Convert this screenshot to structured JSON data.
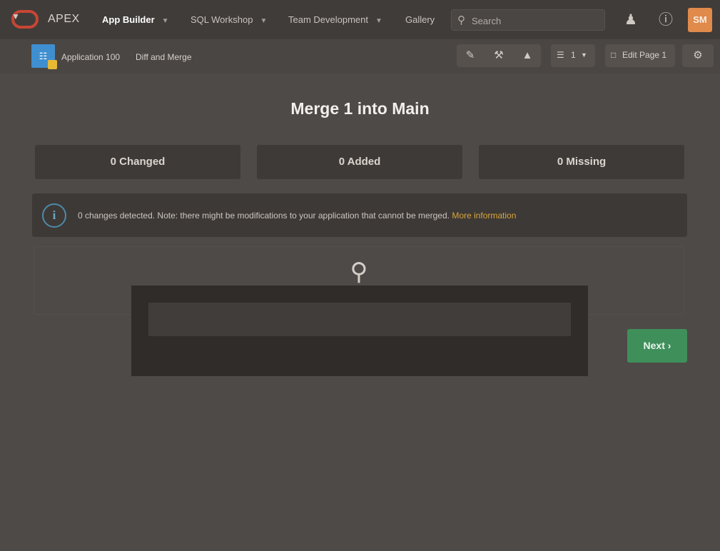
{
  "header": {
    "brand": "APEX",
    "nav": [
      {
        "label": "App Builder",
        "active": true,
        "has_menu": true
      },
      {
        "label": "SQL Workshop",
        "active": false,
        "has_menu": true
      },
      {
        "label": "Team Development",
        "active": false,
        "has_menu": true
      },
      {
        "label": "Gallery",
        "active": false,
        "has_menu": false
      }
    ],
    "search_placeholder": "Search",
    "search_icon": "magnifier-icon",
    "icons": [
      "people-icon",
      "help-icon"
    ],
    "avatar_initials": "SM",
    "colors": {
      "brand_logo": "#c74634",
      "avatar": "#e08a4c"
    }
  },
  "subheader": {
    "breadcrumb": [
      "Application 100",
      "Diff and Merge"
    ],
    "tools": {
      "group1": [
        "edit-icon",
        "wrench-icon",
        "shared-components-icon"
      ],
      "group2_value": "1",
      "edit_page_label": "Edit Page 1"
    }
  },
  "main": {
    "title": "Merge 1 into Main",
    "stats": [
      {
        "label": "0 Changed"
      },
      {
        "label": "0 Added"
      },
      {
        "label": "0 Missing"
      }
    ],
    "alert": {
      "icon": "info-icon",
      "text": "0 changes detected. Note: there might be modifications to your application that cannot be merged.",
      "link": "More information"
    },
    "next_label": "Next",
    "next_color": "#3f8f5a"
  }
}
